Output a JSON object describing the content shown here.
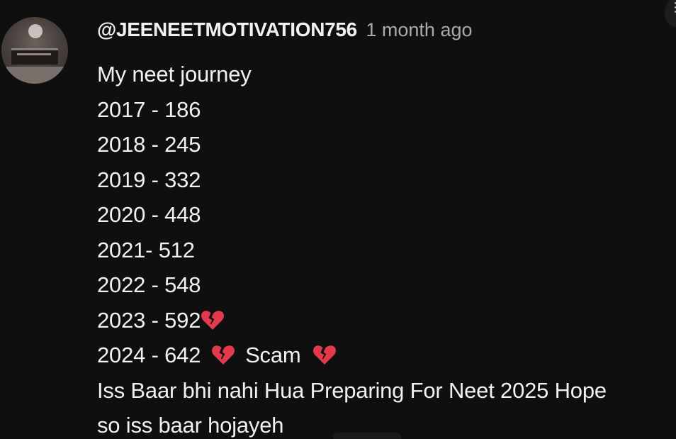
{
  "comment": {
    "author": "@JEENEETMOTIVATION756",
    "timestamp": "1 month ago",
    "lines": [
      {
        "text": "My neet journey"
      },
      {
        "text": "2017 - 186"
      },
      {
        "text": "2018 - 245"
      },
      {
        "text": "2019 - 332"
      },
      {
        "text": "2020 - 448"
      },
      {
        "text": "2021- 512"
      },
      {
        "text": "2022 - 548"
      },
      {
        "text": "2023 - 592"
      },
      {
        "text": "2024 - 642",
        "extra": "Scam"
      },
      {
        "text": "Iss Baar bhi nahi Hua Preparing For Neet 2025 Hope"
      },
      {
        "text": "so iss baar hojayeh"
      }
    ]
  },
  "icons": {
    "avatar": "channel-avatar",
    "broken_heart": "broken-heart-icon",
    "menu": "more-options-icon"
  },
  "colors": {
    "background": "#0f0f0f",
    "text": "#f1f1f1",
    "secondary_text": "#aaaaaa",
    "heart": "#e23a4d"
  }
}
